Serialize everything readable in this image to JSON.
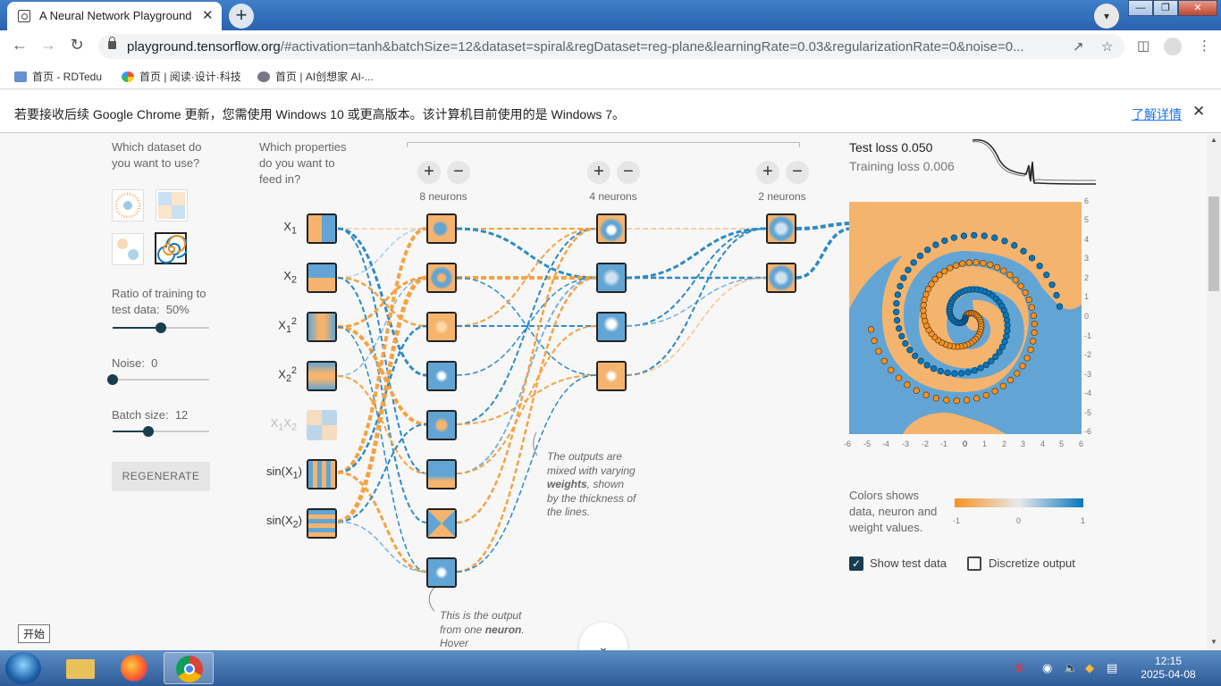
{
  "browser": {
    "tab_title": "A Neural Network Playground",
    "tab_close": "✕",
    "new_tab": "+",
    "url_host": "playground.tensorflow.org",
    "url_rest": "/#activation=tanh&batchSize=12&dataset=spiral&regDataset=reg-plane&learningRate=0.03&regularizationRate=0&noise=0...",
    "bookmarks": [
      "首页 - RDTedu",
      "首页 | 阅读·设计·科技",
      "首页 | AI创想家 AI-..."
    ],
    "infobar_text": "若要接收后续 Google Chrome 更新，您需使用 Windows 10 或更高版本。该计算机目前使用的是 Windows 7。",
    "infobar_link": "了解详情",
    "infobar_close": "✕"
  },
  "data_panel": {
    "dataset_question": "Which dataset do you want to use?",
    "ratio_label": "Ratio of training to test data:",
    "ratio_value": "50%",
    "ratio_fraction": 0.5,
    "noise_label": "Noise:",
    "noise_value": "0",
    "noise_fraction": 0,
    "batch_label": "Batch size:",
    "batch_value": "12",
    "batch_fraction": 0.37,
    "regenerate": "REGENERATE"
  },
  "features": {
    "question": "Which properties do you want to feed in?",
    "items": [
      {
        "label": "X",
        "sub": "1",
        "sup": ""
      },
      {
        "label": "X",
        "sub": "2",
        "sup": ""
      },
      {
        "label": "X",
        "sub": "1",
        "sup": "2"
      },
      {
        "label": "X",
        "sub": "2",
        "sup": "2"
      },
      {
        "label": "X",
        "sub": "1",
        "sup": "",
        "extra": "X",
        "extra_sub": "2"
      },
      {
        "label": "sin(X",
        "sub": "1",
        "sup": "",
        "tail": ")"
      },
      {
        "label": "sin(X",
        "sub": "2",
        "sup": "",
        "tail": ")"
      }
    ]
  },
  "network": {
    "plus": "+",
    "minus": "−",
    "layers": [
      "8 neurons",
      "4 neurons",
      "2 neurons"
    ],
    "note_weights": {
      "pre": "The outputs are mixed with varying ",
      "bold": "weights",
      "post": ", shown by the thickness of the lines."
    },
    "note_neuron": {
      "pre": "This is the output from one ",
      "bold": "neuron",
      "post": ". Hover"
    }
  },
  "output": {
    "test_loss": "Test loss 0.050",
    "training_loss": "Training loss 0.006",
    "x_ticks": [
      "-6",
      "-5",
      "-4",
      "-3",
      "-2",
      "-1",
      "0",
      "1",
      "2",
      "3",
      "4",
      "5",
      "6"
    ],
    "y_ticks": [
      "6",
      "5",
      "4",
      "3",
      "2",
      "1",
      "0",
      "-1",
      "-2",
      "-3",
      "-4",
      "-5",
      "-6"
    ],
    "colors_text": "Colors shows data, neuron and weight values.",
    "scale_ticks": [
      "-1",
      "0",
      "1"
    ],
    "show_test": "Show test data",
    "discretize": "Discretize output",
    "check_mark": "✓"
  },
  "colors": {
    "orange": "#f59322",
    "blue": "#0877bd",
    "light_orange": "#f5b46e",
    "light_blue": "#62a5d4"
  },
  "os": {
    "start_tooltip": "开始",
    "time": "12:15",
    "date": "2025-04-08"
  }
}
